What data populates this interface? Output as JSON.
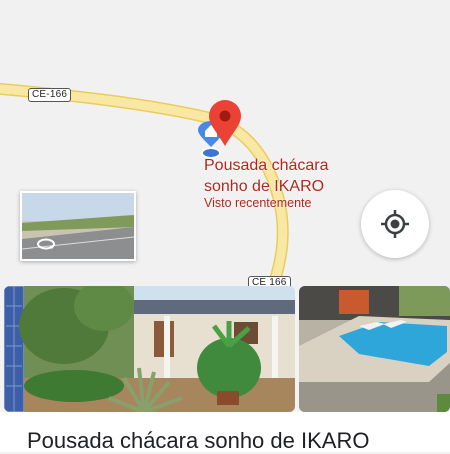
{
  "map": {
    "road_shields": [
      "CE-166",
      "CE 166"
    ],
    "place_name_line1": "Pousada chácara",
    "place_name_line2": "sonho de IKARO",
    "place_status": "Visto recentemente",
    "colors": {
      "road": "#f7e49a",
      "road_edge": "#e9cd5c",
      "pin": "#ea4335",
      "home_pin": "#4a88e8"
    }
  },
  "place_card": {
    "title": "Pousada chácara sonho de IKARO"
  }
}
